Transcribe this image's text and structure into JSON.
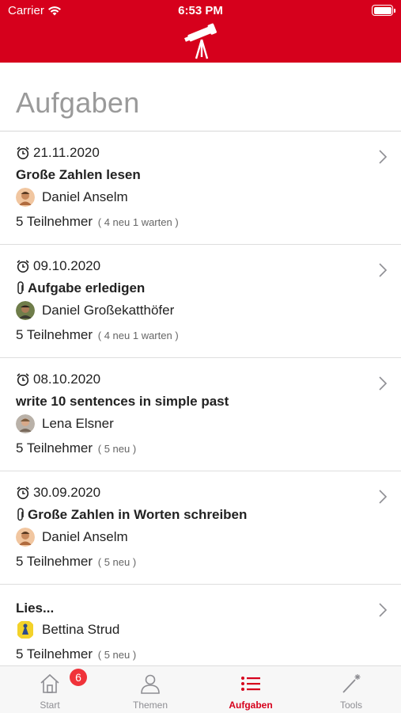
{
  "status": {
    "carrier": "Carrier",
    "time": "6:53 PM"
  },
  "header": {
    "logo_icon": "telescope-icon",
    "brand_color": "#d6001c"
  },
  "page": {
    "title": "Aufgaben"
  },
  "tasks": [
    {
      "date": "21.11.2020",
      "title": "Große Zahlen lesen",
      "attachment": false,
      "teacher": "Daniel Anselm",
      "participants": "5 Teilnehmer",
      "participants_detail": "( 4 neu 1 warten )"
    },
    {
      "date": "09.10.2020",
      "title": "Aufgabe erledigen",
      "attachment": true,
      "teacher": "Daniel Großekatthöfer",
      "participants": "5 Teilnehmer",
      "participants_detail": "( 4 neu 1 warten )"
    },
    {
      "date": "08.10.2020",
      "title": "write 10 sentences in simple past",
      "attachment": false,
      "teacher": "Lena Elsner",
      "participants": "5 Teilnehmer",
      "participants_detail": "( 5 neu )"
    },
    {
      "date": "30.09.2020",
      "title": "Große Zahlen in Worten schreiben",
      "attachment": true,
      "teacher": "Daniel Anselm",
      "participants": "5 Teilnehmer",
      "participants_detail": "( 5 neu )"
    },
    {
      "date": "",
      "title": "Lies...",
      "attachment": false,
      "teacher": "Bettina Strud",
      "participants": "5 Teilnehmer",
      "participants_detail": "( 5 neu )"
    }
  ],
  "tabbar": {
    "tabs": [
      {
        "label": "Start",
        "icon": "home-icon",
        "badge": "6"
      },
      {
        "label": "Themen",
        "icon": "person-icon"
      },
      {
        "label": "Aufgaben",
        "icon": "list-icon",
        "active": true
      },
      {
        "label": "Tools",
        "icon": "magic-wand-icon"
      }
    ]
  }
}
